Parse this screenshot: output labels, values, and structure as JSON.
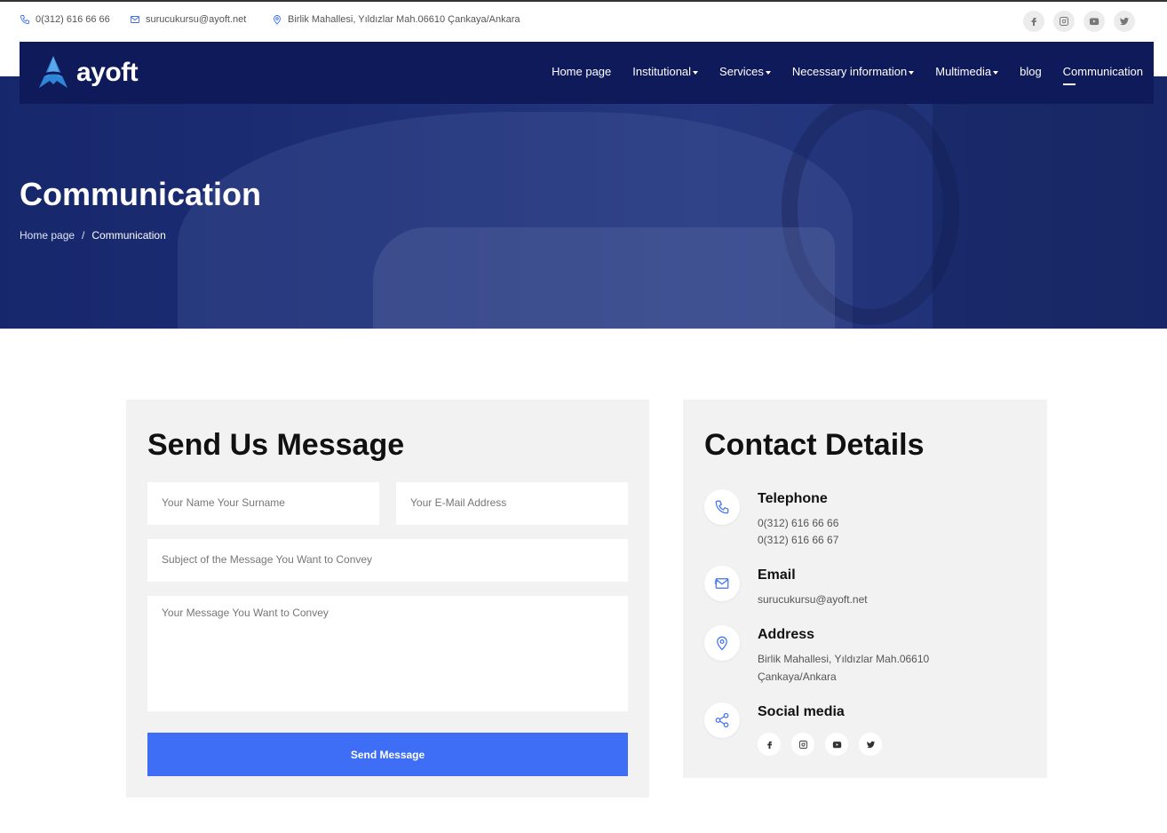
{
  "topbar": {
    "phone": "0(312) 616 66 66",
    "email": "surucukursu@ayoft.net",
    "address": "Birlik Mahallesi, Yıldızlar Mah.06610 Çankaya/Ankara",
    "social_icons": [
      "facebook-icon",
      "instagram-icon",
      "youtube-icon",
      "twitter-icon"
    ]
  },
  "navbar": {
    "logo_text": "ayoft",
    "menu": [
      {
        "label": "Home page",
        "dropdown": false
      },
      {
        "label": "Institutional",
        "dropdown": true
      },
      {
        "label": "Services",
        "dropdown": true
      },
      {
        "label": "Necessary information",
        "dropdown": true
      },
      {
        "label": "Multimedia",
        "dropdown": true
      },
      {
        "label": "blog",
        "dropdown": false
      },
      {
        "label": "Communication",
        "dropdown": false,
        "active": true
      }
    ]
  },
  "hero": {
    "title": "Communication",
    "breadcrumb": {
      "home": "Home page",
      "separator": "/",
      "current": "Communication"
    }
  },
  "form": {
    "title": "Send Us Message",
    "name_placeholder": "Your Name Your Surname",
    "email_placeholder": "Your E-Mail Address",
    "subject_placeholder": "Subject of the Message You Want to Convey",
    "message_placeholder": "Your Message You Want to Convey",
    "submit_label": "Send Message"
  },
  "contact": {
    "title": "Contact Details",
    "telephone": {
      "label": "Telephone",
      "line1": "0(312) 616 66 66",
      "line2": "0(312) 616 66 67"
    },
    "email": {
      "label": "Email",
      "value": "surucukursu@ayoft.net"
    },
    "address": {
      "label": "Address",
      "line1": "Birlik Mahallesi, Yıldızlar Mah.06610",
      "line2": "Çankaya/Ankara"
    },
    "social": {
      "label": "Social media",
      "icons": [
        "facebook-icon",
        "instagram-icon",
        "youtube-icon",
        "twitter-icon"
      ]
    }
  },
  "colors": {
    "navbar_bg": "#0e1a5a",
    "accent": "#3d6ef5",
    "card_bg": "#f2f2f2"
  }
}
